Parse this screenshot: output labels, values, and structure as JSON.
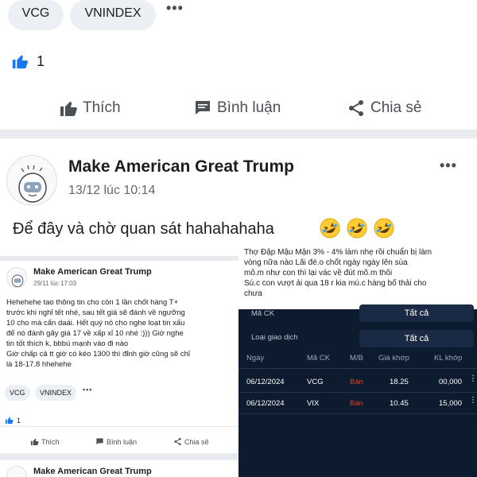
{
  "top_post": {
    "tags": [
      "VCG",
      "VNINDEX"
    ],
    "more_label": "•••",
    "like_count": "1",
    "actions": {
      "like": "Thích",
      "comment": "Bình luận",
      "share": "Chia sẻ"
    }
  },
  "post": {
    "author": "Make American Great Trump",
    "time": "13/12 lúc 10:14",
    "more_label": "•••",
    "text": "Để đây và chờ quan sát hahahahaha",
    "emojis": [
      "rofl-emoji",
      "rofl-emoji",
      "rofl-emoji"
    ]
  },
  "embedded_left": {
    "author": "Make American Great Trump",
    "time": "29/11 lúc 17:03",
    "body": [
      "Hehehehe tao thông tin cho còn 1 lần chốt hàng T+",
      "trước khi nghỉ tết nhé, sau tết giá sẽ đánh về ngưỡng",
      "10 cho mà cẩn daái. Hết quý nó cho nghe loạt tin xấu",
      "để nó đánh gãy giá 17 về xấp xỉ 10 nhé :))) Giờ nghe",
      "tin tốt thích k, bbbú mạnh vào đi nào",
      "Giờ chấp cả tt giờ có kéo 1300 thì đỉnh giờ cũng sẽ chỉ",
      "là 18-17.8 hhehehe"
    ],
    "tags": [
      "VCG",
      "VNINDEX"
    ],
    "more_label": "•••",
    "like_count": "1",
    "actions": {
      "like": "Thích",
      "comment": "Bình luận",
      "share": "Chia sẻ"
    },
    "next_author": "Make American Great Trump"
  },
  "embedded_right": {
    "caption_lines": [
      "Thợ Đập Mậu Mận  3% - 4% làm nhẹ rồi chuẩn bị làm",
      "vòng nữa nào   Lãi đé.o chốt ngày ngày lên sùa",
      "mõ.m như con   thì lại vác   về đút mõ.m thôi",
      "Sú.c con vượt ải qua 18 r kia mú.c hàng bố thải cho",
      "chưa"
    ],
    "filter_partial_label": "Mã CK",
    "filter_partial_value": "Tất cả",
    "filter_label": "Loại giao dịch",
    "filter_value": "Tất cả",
    "columns": [
      "Ngày",
      "Mã CK",
      "M/B",
      "Giá khớp",
      "KL khớp"
    ],
    "rows": [
      {
        "date": "06/12/2024",
        "symbol": "VCG",
        "side": "Bán",
        "price": "18.25",
        "volume": "00,000"
      },
      {
        "date": "06/12/2024",
        "symbol": "VIX",
        "side": "Bán",
        "price": "10.45",
        "volume": "15,000"
      }
    ],
    "colors": {
      "panel": "#0d1b2e",
      "sell": "#e0412f"
    }
  },
  "colors": {
    "brand_blue": "#1877f2",
    "muted": "#65676b",
    "divider": "#e9ebee"
  }
}
